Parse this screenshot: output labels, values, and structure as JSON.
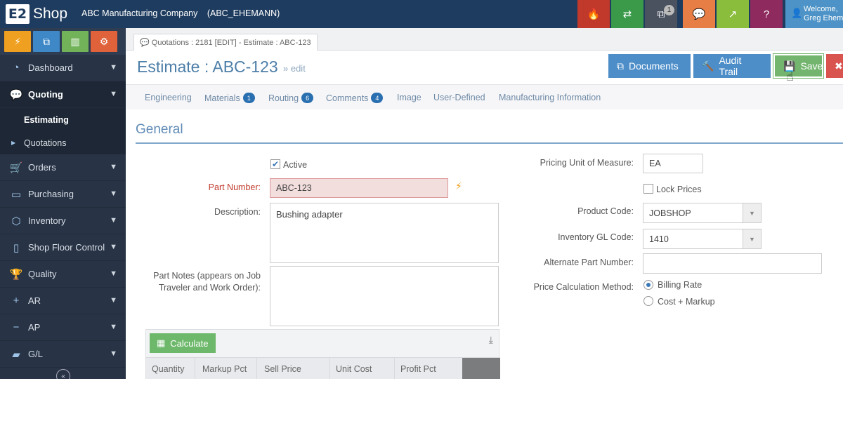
{
  "app": {
    "logo_mark": "E2",
    "logo_text": "Shop",
    "company": "ABC Manufacturing Company",
    "company_code": "(ABC_EHEMANN)"
  },
  "topbar": {
    "buttons": [
      {
        "icon": "flame-icon",
        "glyph": "🔥",
        "color": "#c0392b"
      },
      {
        "icon": "exchange-icon",
        "glyph": "⇄",
        "color": "#3a9a4a"
      },
      {
        "icon": "org-chart-icon",
        "glyph": "⧉",
        "color": "#4a5260",
        "badge": "1"
      },
      {
        "icon": "chat-icon",
        "glyph": "💬",
        "color": "#e67e45"
      },
      {
        "icon": "external-link-icon",
        "glyph": "↗",
        "color": "#8bbd3c"
      },
      {
        "icon": "help-icon",
        "glyph": "?",
        "color": "#8e2a5e"
      }
    ],
    "welcome": "Welcome,",
    "user_name": "Greg Ehemann"
  },
  "quick_buttons": [
    {
      "icon": "bolt-icon",
      "glyph": "⚡",
      "color": "#f0a020"
    },
    {
      "icon": "hierarchy-icon",
      "glyph": "⧉",
      "color": "#3e88c8"
    },
    {
      "icon": "bar-chart-icon",
      "glyph": "▥",
      "color": "#72b35a"
    },
    {
      "icon": "cogs-icon",
      "glyph": "⚙",
      "color": "#e0623a"
    }
  ],
  "sidebar": {
    "items": [
      {
        "label": "Dashboard",
        "icon": "dashboard-icon",
        "glyph": "◔"
      },
      {
        "label": "Quoting",
        "icon": "chat-icon",
        "glyph": "💬",
        "active": true
      },
      {
        "label": "Orders",
        "icon": "cart-icon",
        "glyph": "🛒"
      },
      {
        "label": "Purchasing",
        "icon": "card-icon",
        "glyph": "▭"
      },
      {
        "label": "Inventory",
        "icon": "cubes-icon",
        "glyph": "⬡"
      },
      {
        "label": "Shop Floor Control",
        "icon": "tablet-icon",
        "glyph": "▯"
      },
      {
        "label": "Quality",
        "icon": "trophy-icon",
        "glyph": "🏆"
      },
      {
        "label": "AR",
        "icon": "plus-icon",
        "glyph": "+"
      },
      {
        "label": "AP",
        "icon": "minus-icon",
        "glyph": "−"
      },
      {
        "label": "G/L",
        "icon": "book-icon",
        "glyph": "▰"
      }
    ],
    "quoting_sub": [
      "Estimating",
      "Quotations"
    ]
  },
  "doc_tab": "Quotations : 2181 [EDIT] - Estimate : ABC-123",
  "page": {
    "title": "Estimate : ABC-123",
    "sub": "» edit"
  },
  "header_buttons": {
    "documents": "Documents",
    "audit": "Audit Trail",
    "save": "Save"
  },
  "subtabs": [
    {
      "label": "Engineering"
    },
    {
      "label": "Materials",
      "count": "1"
    },
    {
      "label": "Routing",
      "count": "6"
    },
    {
      "label": "Comments",
      "count": "4"
    },
    {
      "label": "Image"
    },
    {
      "label": "User-Defined"
    },
    {
      "label": "Manufacturing Information"
    }
  ],
  "general": {
    "title": "General",
    "active_label": "Active",
    "part_number_label": "Part Number:",
    "part_number": "ABC-123",
    "description_label": "Description:",
    "description": "Bushing adapter",
    "part_notes_label_1": "Part Notes (appears on Job",
    "part_notes_label_2": "Traveler and Work Order):",
    "pricing_uom_label": "Pricing Unit of Measure:",
    "pricing_uom": "EA",
    "lock_prices_label": "Lock Prices",
    "product_code_label": "Product Code:",
    "product_code": "JOBSHOP",
    "inventory_gl_label": "Inventory GL Code:",
    "inventory_gl": "1410",
    "alt_part_label": "Alternate Part Number:",
    "alt_part": "",
    "price_calc_label": "Price Calculation Method:",
    "billing_rate": "Billing Rate",
    "cost_markup": "Cost + Markup"
  },
  "calc": {
    "button": "Calculate",
    "columns": [
      "Quantity",
      "Markup Pct",
      "Sell Price",
      "Unit Cost",
      "Profit Pct"
    ]
  }
}
